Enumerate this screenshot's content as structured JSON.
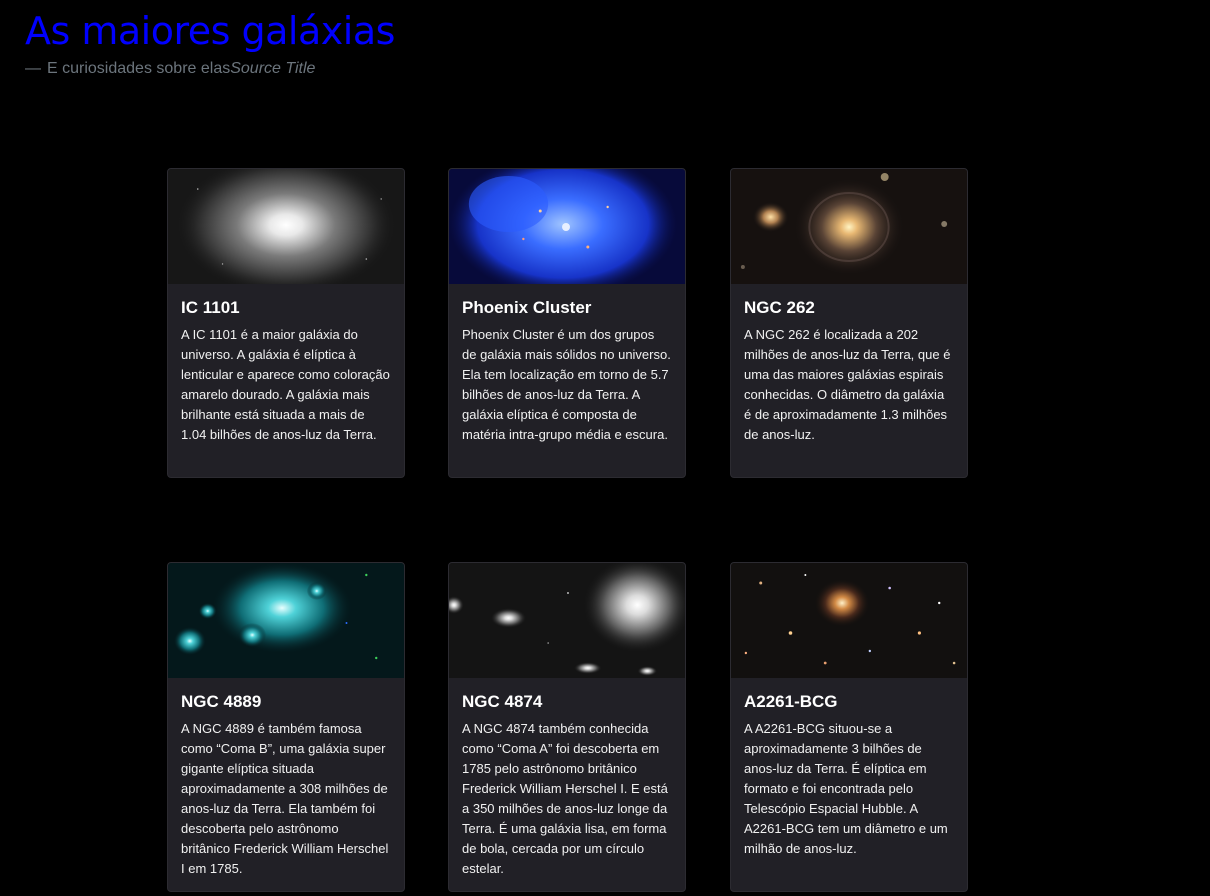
{
  "header": {
    "title": "As maiores galáxias",
    "dash": "—",
    "subtitle": "E curiosidades sobre elas",
    "source": "Source Title"
  },
  "cards": [
    {
      "title": "IC 1101",
      "text": "A IC 1101 é a maior galáxia do universo. A galáxia é elíptica à lenticular e aparece como coloração amarelo dourado. A galáxia mais brilhante está situada a mais de 1.04 bilhões de anos-luz da Terra."
    },
    {
      "title": "Phoenix Cluster",
      "text": "Phoenix Cluster é um dos grupos de galáxia mais sólidos no universo. Ela tem localização em torno de 5.7 bilhões de anos-luz da Terra. A galáxia elíptica é composta de matéria intra-grupo média e escura."
    },
    {
      "title": "NGC 262",
      "text": "A NGC 262 é localizada a 202 milhões de anos-luz da Terra, que é uma das maiores galáxias espirais conhecidas. O diâmetro da galáxia é de aproximadamente 1.3 milhões de anos-luz."
    },
    {
      "title": "NGC 4889",
      "text": "A NGC 4889 é também famosa como “Coma B”, uma galáxia super gigante elíptica situada aproximadamente a 308 milhões de anos-luz da Terra. Ela também foi descoberta pelo astrônomo britânico Frederick William Herschel I em 1785."
    },
    {
      "title": "NGC 4874",
      "text": "A NGC 4874 também conhecida como “Coma A” foi descoberta em 1785 pelo astrônomo britânico Frederick William Herschel I. E está a 350 milhões de anos-luz longe da Terra. É uma galáxia lisa, em forma de bola, cercada por um círculo estelar."
    },
    {
      "title": "A2261-BCG",
      "text": "A A2261-BCG situou-se a aproximadamente 3 bilhões de anos-luz da Terra. É elíptica em formato e foi encontrada pelo Telescópio Espacial Hubble. A A2261-BCG tem um diâmetro e um milhão de anos-luz."
    }
  ],
  "colors": {
    "background": "#000000",
    "title": "#0000ff",
    "subtitle": "#6c757d",
    "card_background": "#212026",
    "card_text": "#f1f1f1"
  }
}
